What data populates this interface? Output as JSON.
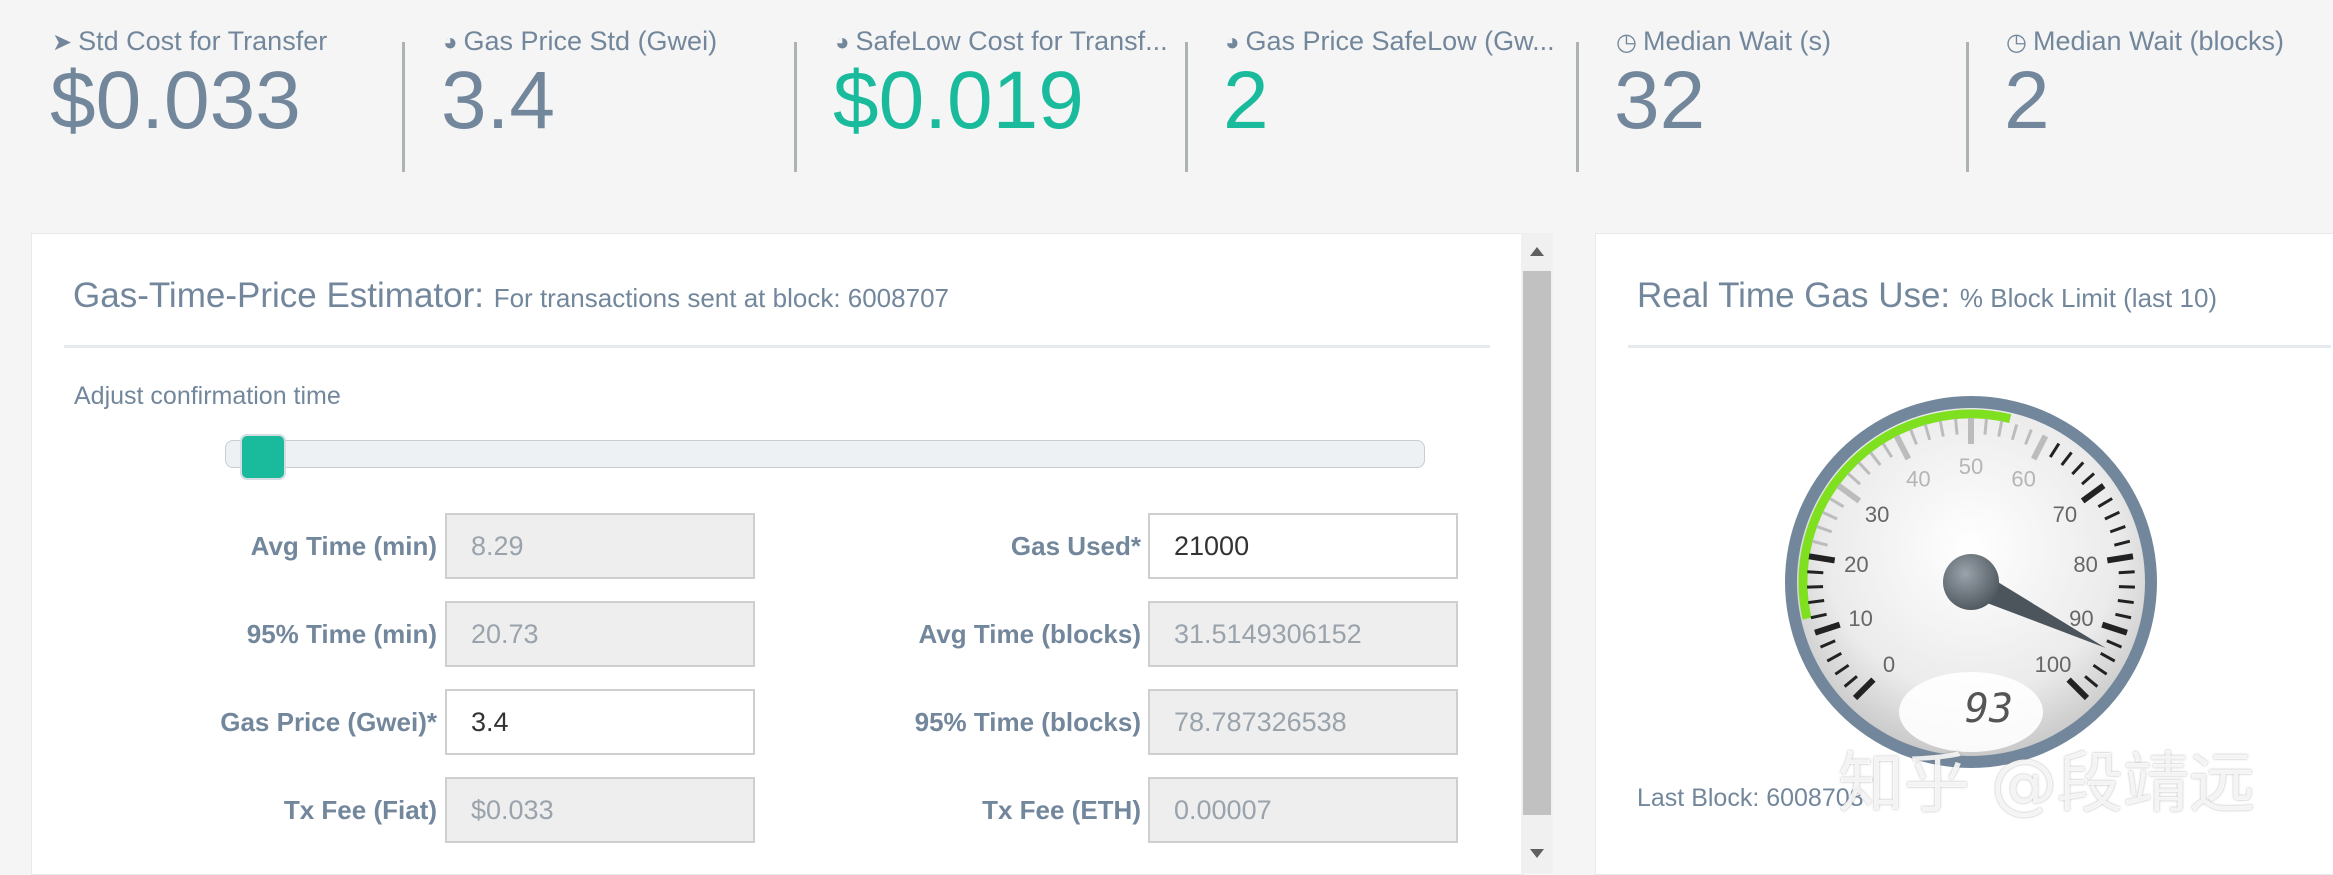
{
  "stats": [
    {
      "icon": "ship-icon",
      "label": "Std Cost for Transfer",
      "value": "$0.033",
      "color": "#73879c"
    },
    {
      "icon": "dashboard-icon",
      "label": "Gas Price Std (Gwei)",
      "value": "3.4",
      "color": "#73879c"
    },
    {
      "icon": "dashboard-icon",
      "label": "SafeLow Cost for Transf...",
      "value": "$0.019",
      "color": "#1abb9c"
    },
    {
      "icon": "dashboard-icon",
      "label": "Gas Price SafeLow (Gw...",
      "value": "2",
      "color": "#1abb9c"
    },
    {
      "icon": "clock-icon",
      "label": "Median Wait (s)",
      "value": "32",
      "color": "#73879c"
    },
    {
      "icon": "clock-icon",
      "label": "Median Wait (blocks)",
      "value": "2",
      "color": "#73879c"
    }
  ],
  "estimator": {
    "title": "Gas-Time-Price Estimator:",
    "subtitle": "For transactions sent at block: 6008707",
    "adjust_label": "Adjust confirmation time",
    "slider_value_fraction": 0.0,
    "left_fields": [
      {
        "label": "Avg Time (min)",
        "value": "8.29",
        "editable": false
      },
      {
        "label": "95% Time (min)",
        "value": "20.73",
        "editable": false
      },
      {
        "label": "Gas Price (Gwei)*",
        "value": "3.4",
        "editable": true
      },
      {
        "label": "Tx Fee (Fiat)",
        "value": "$0.033",
        "editable": false
      }
    ],
    "right_fields": [
      {
        "label": "Gas Used*",
        "value": "21000",
        "editable": true
      },
      {
        "label": "Avg Time (blocks)",
        "value": "31.5149306152",
        "editable": false
      },
      {
        "label": "95% Time (blocks)",
        "value": "78.787326538",
        "editable": false
      },
      {
        "label": "Tx Fee (ETH)",
        "value": "0.00007",
        "editable": false
      }
    ]
  },
  "gas_use": {
    "title": "Real Time Gas Use:",
    "subtitle": "% Block Limit (last 10)",
    "gauge_value": 93,
    "gauge_display": "93",
    "gauge_ticks": [
      "0",
      "10",
      "20",
      "30",
      "40",
      "50",
      "60",
      "70",
      "80",
      "90",
      "100"
    ],
    "last_block_label": "Last Block: 6008708"
  },
  "watermark": "知乎 @段靖远",
  "colors": {
    "accent": "#1abb9c",
    "text": "#73879c",
    "gauge_green": "#7ee01e"
  }
}
